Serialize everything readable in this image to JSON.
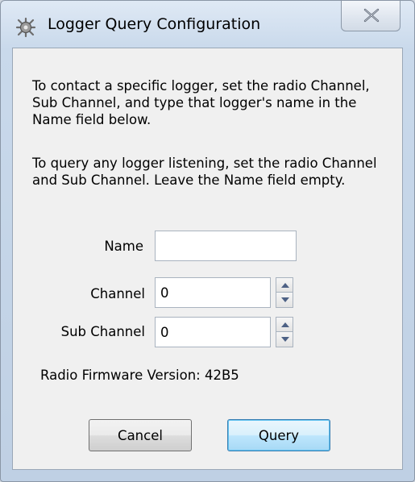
{
  "window": {
    "title": "Logger Query Configuration",
    "icon": "logger-gear-icon",
    "close_icon": "close-icon"
  },
  "instructions": {
    "paragraph1": "To contact a specific logger, set the radio Channel, Sub Channel, and type that logger's name in the Name field below.",
    "paragraph2": "To query any logger listening, set the radio Channel and Sub Channel. Leave the Name field empty."
  },
  "form": {
    "name_label": "Name",
    "name_value": "",
    "channel_label": "Channel",
    "channel_value": "0",
    "sub_channel_label": "Sub Channel",
    "sub_channel_value": "0"
  },
  "firmware": {
    "text": "Radio Firmware Version: 42B5"
  },
  "buttons": {
    "cancel_label": "Cancel",
    "query_label": "Query"
  },
  "colors": {
    "default_button_border": "#3c7fb1",
    "client_background": "#f0f0f0"
  }
}
